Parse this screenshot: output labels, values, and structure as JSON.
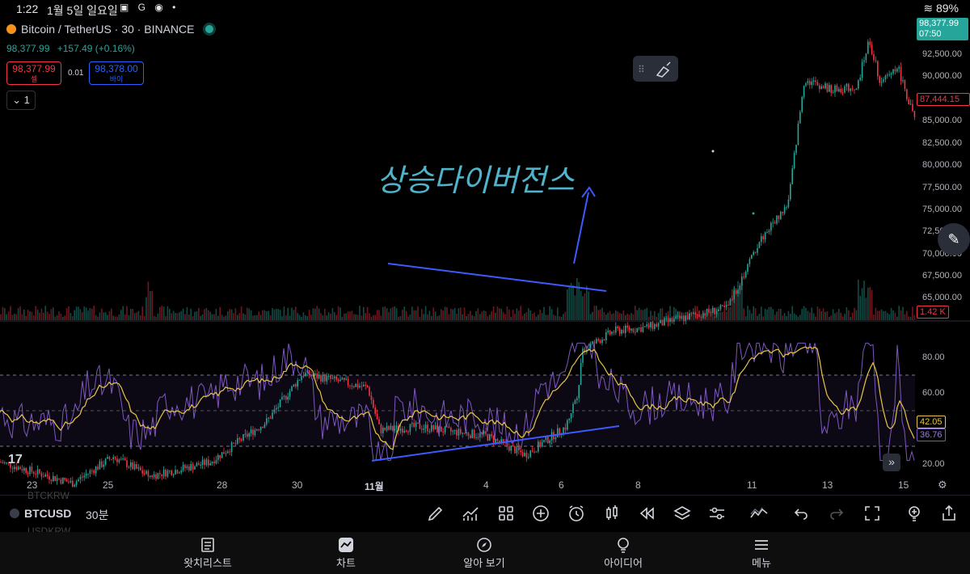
{
  "status_bar": {
    "time": "1:22",
    "date": "1월 5일 일요일",
    "icons": "▣ G ◉ •",
    "battery": "89%"
  },
  "header": {
    "symbol": "Bitcoin / TetherUS · 30 · BINANCE",
    "last_price": "98,377.99",
    "change": "+157.49 (+0.16%)",
    "sell_price": "98,377.99",
    "sell_label": "셀",
    "spread": "0.01",
    "buy_price": "98,378.00",
    "buy_label": "바이",
    "interval_count": "1"
  },
  "price_axis": {
    "labels": [
      "92,500.00",
      "90,000.00",
      "87,500.00",
      "85,000.00",
      "82,500.00",
      "80,000.00",
      "77,500.00",
      "75,000.00",
      "72,500.00",
      "70,000.00",
      "67,500.00",
      "65,000.00"
    ],
    "current_price": "98,377.99",
    "countdown": "07:50",
    "marker_price": "87,444.15",
    "volume_tag": "1.42 K"
  },
  "rsi_axis": {
    "labels": [
      "80.00",
      "60.00",
      "20.00"
    ],
    "rsi_value": "42.05",
    "rsi_ma": "36.76"
  },
  "annotation": {
    "text": "상승다이버전스"
  },
  "time_axis": [
    "23",
    "25",
    "28",
    "30",
    "11월",
    "4",
    "6",
    "8",
    "11",
    "13",
    "15"
  ],
  "toolbar": {
    "symbol": "BTCUSD",
    "interval": "30분",
    "ghost_top": "BTCKRW",
    "ghost_bottom": "USDKRW"
  },
  "bottom_nav": [
    {
      "label": "왓치리스트",
      "icon": "list-icon"
    },
    {
      "label": "차트",
      "icon": "chart-icon"
    },
    {
      "label": "알아 보기",
      "icon": "compass-icon"
    },
    {
      "label": "아이디어",
      "icon": "bulb-icon"
    },
    {
      "label": "메뉴",
      "icon": "menu-icon"
    }
  ],
  "colors": {
    "up": "#26a69a",
    "down": "#f23645",
    "rsi": "#7e57c2",
    "rsi_ma": "#e8c547",
    "trendline": "#3d5afe",
    "annotation": "#4fb3c9"
  }
}
